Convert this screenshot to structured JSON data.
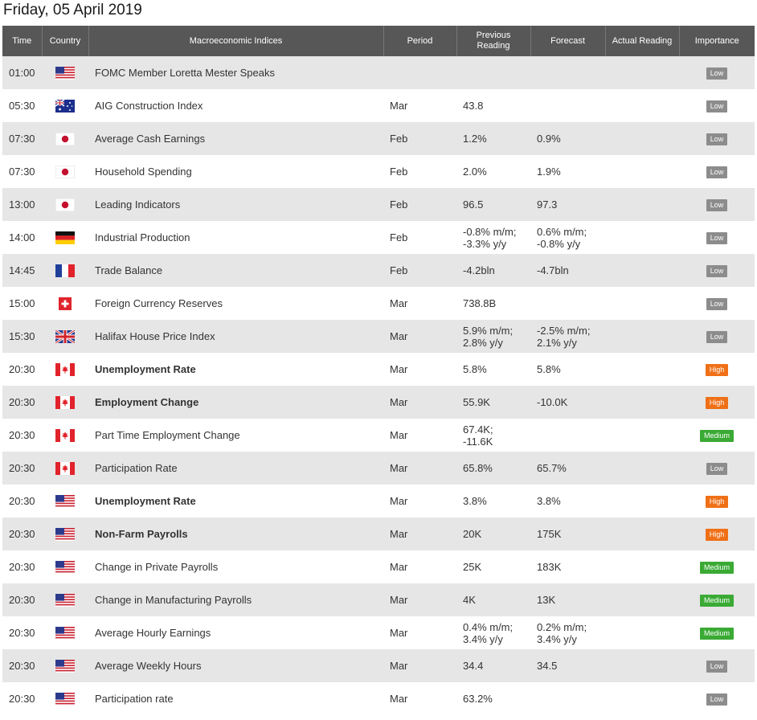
{
  "page_title": "Friday, 05 April 2019",
  "columns": {
    "time": "Time",
    "country": "Country",
    "indices": "Macroeconomic Indices",
    "period": "Period",
    "previous_line1": "Previous",
    "previous_line2": "Reading",
    "forecast": "Forecast",
    "actual": "Actual Reading",
    "importance": "Importance"
  },
  "colors": {
    "header_bg": "#575757",
    "row_shaded": "#e6e6e6",
    "low": "#8c8c8c",
    "high": "#ef7017",
    "medium": "#3aaa35"
  },
  "rows": [
    {
      "time": "01:00",
      "flag": "us-flag-icon",
      "indicator": "FOMC Member Loretta Mester Speaks",
      "bold": false,
      "period": "",
      "previous": "",
      "previous2": "",
      "forecast": "",
      "forecast2": "",
      "actual": "",
      "importance": "Low"
    },
    {
      "time": "05:30",
      "flag": "au-flag-icon",
      "indicator": "AIG Construction Index",
      "bold": false,
      "period": "Mar",
      "previous": "43.8",
      "previous2": "",
      "forecast": "",
      "forecast2": "",
      "actual": "",
      "importance": "Low"
    },
    {
      "time": "07:30",
      "flag": "jp-flag-icon",
      "indicator": "Average Cash Earnings",
      "bold": false,
      "period": "Feb",
      "previous": "1.2%",
      "previous2": "",
      "forecast": "0.9%",
      "forecast2": "",
      "actual": "",
      "importance": "Low"
    },
    {
      "time": "07:30",
      "flag": "jp-flag-icon",
      "indicator": "Household Spending",
      "bold": false,
      "period": "Feb",
      "previous": "2.0%",
      "previous2": "",
      "forecast": "1.9%",
      "forecast2": "",
      "actual": "",
      "importance": "Low"
    },
    {
      "time": "13:00",
      "flag": "jp-flag-icon",
      "indicator": "Leading Indicators",
      "bold": false,
      "period": "Feb",
      "previous": "96.5",
      "previous2": "",
      "forecast": "97.3",
      "forecast2": "",
      "actual": "",
      "importance": "Low"
    },
    {
      "time": "14:00",
      "flag": "de-flag-icon",
      "indicator": "Industrial Production",
      "bold": false,
      "period": "Feb",
      "previous": "-0.8% m/m;",
      "previous2": "-3.3% y/y",
      "forecast": "0.6% m/m;",
      "forecast2": "-0.8% y/y",
      "actual": "",
      "importance": "Low"
    },
    {
      "time": "14:45",
      "flag": "fr-flag-icon",
      "indicator": "Trade Balance",
      "bold": false,
      "period": "Feb",
      "previous": "-4.2bln",
      "previous2": "",
      "forecast": "-4.7bln",
      "forecast2": "",
      "actual": "",
      "importance": "Low"
    },
    {
      "time": "15:00",
      "flag": "ch-flag-icon",
      "indicator": "Foreign Currency Reserves",
      "bold": false,
      "period": "Mar",
      "previous": "738.8B",
      "previous2": "",
      "forecast": "",
      "forecast2": "",
      "actual": "",
      "importance": "Low"
    },
    {
      "time": "15:30",
      "flag": "gb-flag-icon",
      "indicator": "Halifax House Price Index",
      "bold": false,
      "period": "Mar",
      "previous": "5.9% m/m;",
      "previous2": "2.8% y/y",
      "forecast": "-2.5% m/m;",
      "forecast2": "2.1% y/y",
      "actual": "",
      "importance": "Low"
    },
    {
      "time": "20:30",
      "flag": "ca-flag-icon",
      "indicator": "Unemployment Rate",
      "bold": true,
      "period": "Mar",
      "previous": "5.8%",
      "previous2": "",
      "forecast": "5.8%",
      "forecast2": "",
      "actual": "",
      "importance": "High"
    },
    {
      "time": "20:30",
      "flag": "ca-flag-icon",
      "indicator": "Employment Change",
      "bold": true,
      "period": "Mar",
      "previous": "55.9K",
      "previous2": "",
      "forecast": "-10.0K",
      "forecast2": "",
      "actual": "",
      "importance": "High"
    },
    {
      "time": "20:30",
      "flag": "ca-flag-icon",
      "indicator": "Part Time Employment Change",
      "bold": false,
      "period": "Mar",
      "previous": "67.4K;",
      "previous2": "-11.6K",
      "forecast": "",
      "forecast2": "",
      "actual": "",
      "importance": "Medium"
    },
    {
      "time": "20:30",
      "flag": "ca-flag-icon",
      "indicator": "Participation Rate",
      "bold": false,
      "period": "Mar",
      "previous": "65.8%",
      "previous2": "",
      "forecast": "65.7%",
      "forecast2": "",
      "actual": "",
      "importance": "Low"
    },
    {
      "time": "20:30",
      "flag": "us-flag-icon",
      "indicator": "Unemployment Rate",
      "bold": true,
      "period": "Mar",
      "previous": "3.8%",
      "previous2": "",
      "forecast": "3.8%",
      "forecast2": "",
      "actual": "",
      "importance": "High"
    },
    {
      "time": "20:30",
      "flag": "us-flag-icon",
      "indicator": "Non-Farm Payrolls",
      "bold": true,
      "period": "Mar",
      "previous": "20K",
      "previous2": "",
      "forecast": "175K",
      "forecast2": "",
      "actual": "",
      "importance": "High"
    },
    {
      "time": "20:30",
      "flag": "us-flag-icon",
      "indicator": "Change in Private Payrolls",
      "bold": false,
      "period": "Mar",
      "previous": "25K",
      "previous2": "",
      "forecast": "183K",
      "forecast2": "",
      "actual": "",
      "importance": "Medium"
    },
    {
      "time": "20:30",
      "flag": "us-flag-icon",
      "indicator": "Change in Manufacturing Payrolls",
      "bold": false,
      "period": "Mar",
      "previous": "4K",
      "previous2": "",
      "forecast": "13K",
      "forecast2": "",
      "actual": "",
      "importance": "Medium"
    },
    {
      "time": "20:30",
      "flag": "us-flag-icon",
      "indicator": "Average Hourly Earnings",
      "bold": false,
      "period": "Mar",
      "previous": "0.4% m/m;",
      "previous2": "3.4% y/y",
      "forecast": "0.2% m/m;",
      "forecast2": "3.4% y/y",
      "actual": "",
      "importance": "Medium"
    },
    {
      "time": "20:30",
      "flag": "us-flag-icon",
      "indicator": "Average Weekly Hours",
      "bold": false,
      "period": "Mar",
      "previous": "34.4",
      "previous2": "",
      "forecast": "34.5",
      "forecast2": "",
      "actual": "",
      "importance": "Low"
    },
    {
      "time": "20:30",
      "flag": "us-flag-icon",
      "indicator": "Participation rate",
      "bold": false,
      "period": "Mar",
      "previous": "63.2%",
      "previous2": "",
      "forecast": "",
      "forecast2": "",
      "actual": "",
      "importance": "Low"
    }
  ]
}
